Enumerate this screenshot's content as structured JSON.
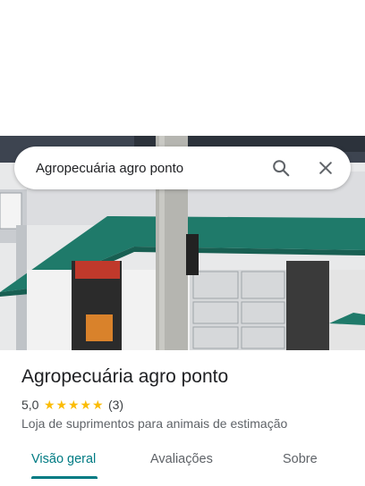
{
  "search": {
    "query": "Agropecuária agro ponto",
    "search_icon": "search-icon",
    "close_icon": "close-icon"
  },
  "photo": {
    "subject": "storefront-photo"
  },
  "place": {
    "name": "Agropecuária agro ponto",
    "rating": "5,0",
    "stars": 5,
    "review_count": "(3)",
    "category": "Loja de suprimentos para animais de estimação"
  },
  "tabs": [
    {
      "label": "Visão geral",
      "active": true
    },
    {
      "label": "Avaliações",
      "active": false
    },
    {
      "label": "Sobre",
      "active": false
    }
  ],
  "colors": {
    "accent": "#007b83",
    "star": "#fbbc04",
    "awning": "#1f7a6a"
  }
}
